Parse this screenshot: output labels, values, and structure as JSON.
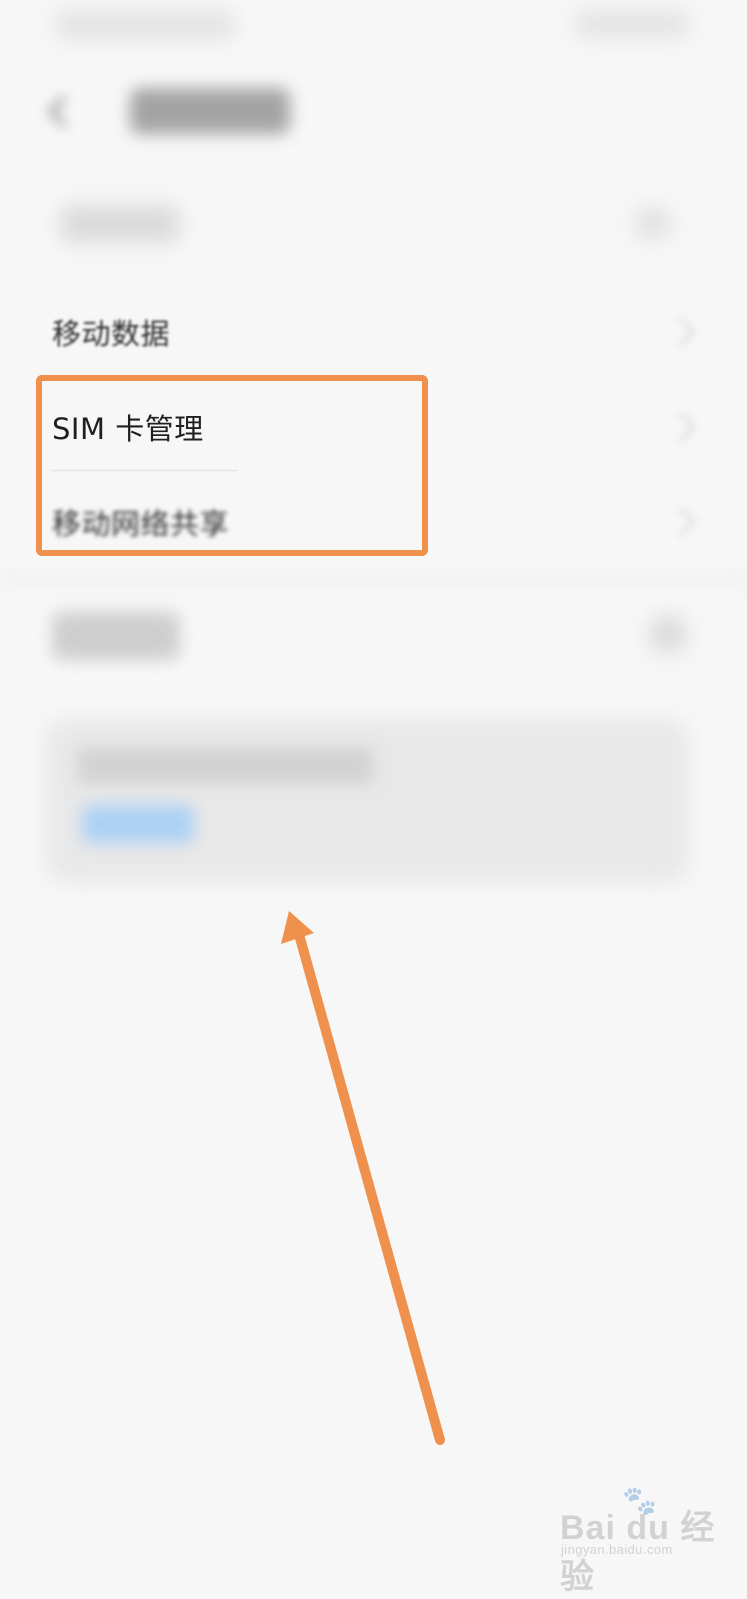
{
  "settings": {
    "rows": [
      {
        "label": "移动数据"
      },
      {
        "label": "SIM 卡管理"
      },
      {
        "label": "移动网络共享"
      }
    ]
  },
  "annotation": {
    "highlight_color": "#ef914d",
    "arrow_color": "#ef914d"
  },
  "watermark": {
    "brand": "Bai du 经验",
    "site": "jingyan.baidu.com"
  },
  "icons": {
    "back": "back-arrow-icon",
    "chevron": "chevron-right-icon",
    "watermark_paw": "paw-icon"
  }
}
